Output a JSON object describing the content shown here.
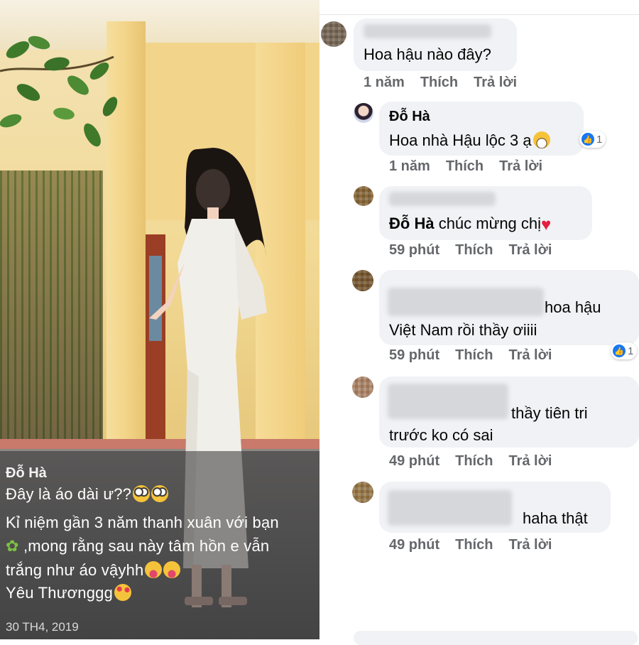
{
  "post": {
    "author": "Đỗ Hà",
    "lines": [
      "Đây là áo dài ư??",
      "Kỉ niệm gần 3 năm thanh xuân với bạn",
      " ,mong rằng sau này tâm hồn e vẫn",
      "trắng như áo vậyhh",
      "Yêu Thươnggg"
    ],
    "date": "30 TH4, 2019"
  },
  "comments": [
    {
      "author": "",
      "text": "Hoa hậu nào đây?",
      "time": "1 năm",
      "like": "Thích",
      "reply": "Trả lời"
    },
    {
      "author": "Đỗ Hà",
      "text": "Hoa nhà Hậu lộc 3 ạ",
      "time": "1 năm",
      "like": "Thích",
      "reply": "Trả lời",
      "reaction_count": "1"
    },
    {
      "author": "",
      "mention": "Đỗ Hà",
      "text": "chúc mừng chị",
      "time": "59 phút",
      "like": "Thích",
      "reply": "Trả lời"
    },
    {
      "author": "",
      "text_line1": "hoa hậu",
      "text_line2": "Việt Nam rồi thầy ơiiii",
      "time": "59 phút",
      "like": "Thích",
      "reply": "Trả lời",
      "reaction_count": "1"
    },
    {
      "author": "",
      "text_line1": "thầy tiên tri",
      "text_line2": "trước ko có sai",
      "time": "49 phút",
      "like": "Thích",
      "reply": "Trả lời"
    },
    {
      "author": "",
      "text": "haha thật",
      "time": "49 phút",
      "like": "Thích",
      "reply": "Trả lời"
    }
  ],
  "colors": {
    "bubble": "#f0f2f5",
    "meta_text": "#65676b",
    "like_blue": "#1877f2",
    "heart_red": "#e41e3f"
  }
}
